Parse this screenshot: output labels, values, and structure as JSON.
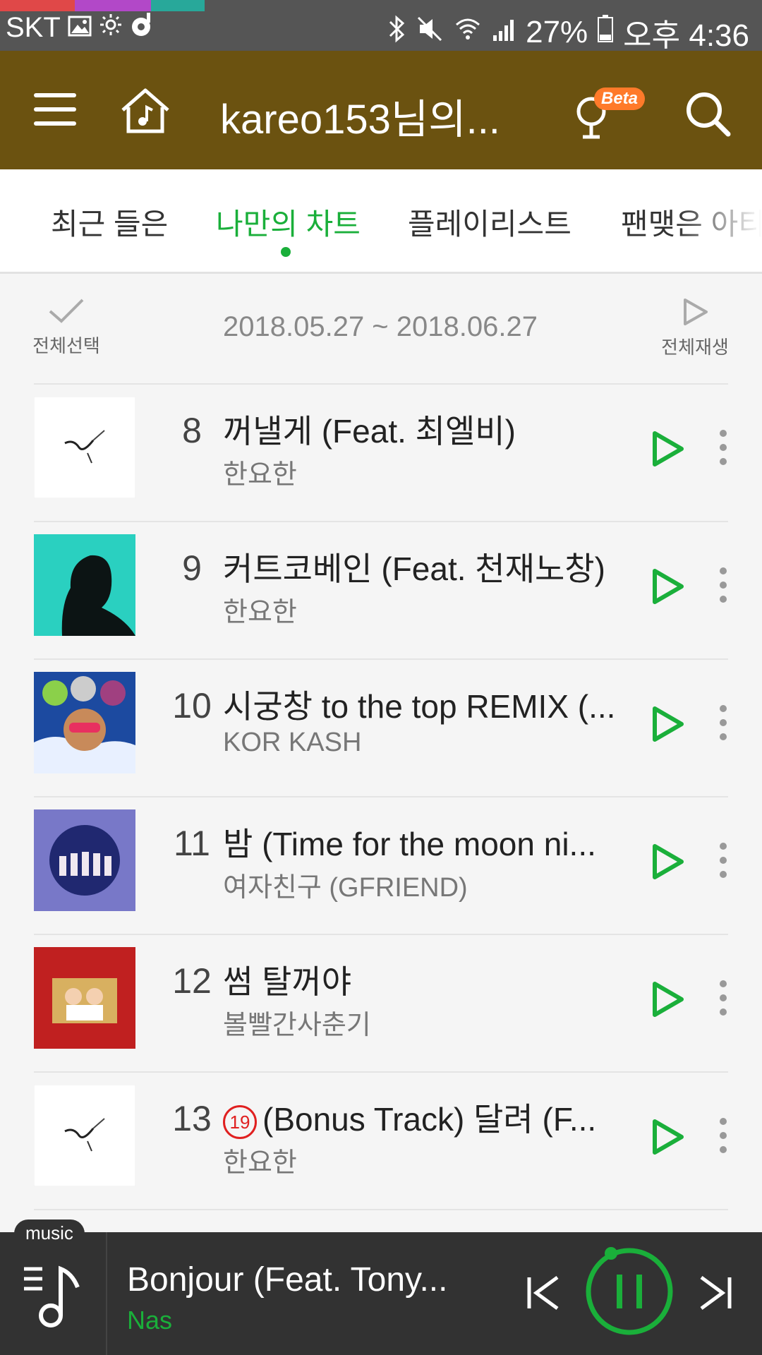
{
  "status_bar": {
    "carrier": "SKT",
    "battery": "27%",
    "time": "오후 4:36",
    "colors": [
      "#e04848",
      "#b248c8",
      "#28a89a"
    ]
  },
  "header": {
    "title": "kareo153님의...",
    "beta_label": "Beta",
    "background": "#6b5210"
  },
  "tabs": [
    {
      "label": "최근 들은",
      "active": false
    },
    {
      "label": "나만의 차트",
      "active": true
    },
    {
      "label": "플레이리스트",
      "active": false
    },
    {
      "label": "팬맺은 아티",
      "active": false
    }
  ],
  "controls": {
    "select_all": "전체선택",
    "date_range": "2018.05.27 ~ 2018.06.27",
    "play_all": "전체재생"
  },
  "songs": [
    {
      "rank": "8",
      "title": "꺼낼게 (Feat. 최엘비)",
      "artist": "한요한",
      "explicit": false
    },
    {
      "rank": "9",
      "title": "커트코베인 (Feat. 천재노창)",
      "artist": "한요한",
      "explicit": false
    },
    {
      "rank": "10",
      "title": "시궁창 to the top REMIX (...",
      "artist": "KOR KASH",
      "explicit": false
    },
    {
      "rank": "11",
      "title": "밤 (Time for the moon ni...",
      "artist": "여자친구 (GFRIEND)",
      "explicit": false
    },
    {
      "rank": "12",
      "title": "썸 탈꺼야",
      "artist": "볼빨간사춘기",
      "explicit": false
    },
    {
      "rank": "13",
      "title": "(Bonus Track) 달려 (F...",
      "artist": "한요한",
      "explicit": true,
      "badge": "19"
    }
  ],
  "player": {
    "tag": "music",
    "title": "Bonjour (Feat. Tony...",
    "artist": "Nas",
    "accent": "#1aaf3a",
    "progress_fraction": 0.02
  }
}
